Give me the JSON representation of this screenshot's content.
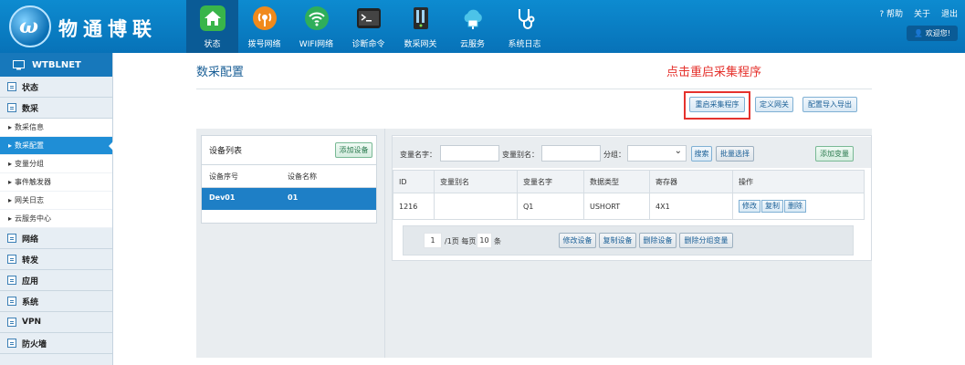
{
  "header": {
    "logo_text": "物通博联",
    "logo_mark": "ω",
    "nav": [
      {
        "label": "状态",
        "icon": "home-icon",
        "active": true
      },
      {
        "label": "拨号网络",
        "icon": "broadcast-icon",
        "active": false
      },
      {
        "label": "WIFI网络",
        "icon": "wifi-icon",
        "active": false
      },
      {
        "label": "诊断命令",
        "icon": "terminal-icon",
        "active": false
      },
      {
        "label": "数采网关",
        "icon": "gateway-icon",
        "active": false
      },
      {
        "label": "云服务",
        "icon": "cloud-icon",
        "active": false
      },
      {
        "label": "系统日志",
        "icon": "stethoscope-icon",
        "active": false
      }
    ],
    "help": "? 帮助",
    "about": "关于",
    "logout": "退出",
    "welcome": "欢迎您!"
  },
  "sidebar": {
    "brand": "WTBLNET",
    "sections": [
      {
        "label": "状态",
        "items": []
      },
      {
        "label": "数采",
        "items": [
          {
            "label": "数采信息",
            "active": false
          },
          {
            "label": "数采配置",
            "active": true
          },
          {
            "label": "变量分组",
            "active": false
          },
          {
            "label": "事件触发器",
            "active": false
          },
          {
            "label": "网关日志",
            "active": false
          },
          {
            "label": "云服务中心",
            "active": false
          }
        ]
      },
      {
        "label": "网络",
        "items": []
      },
      {
        "label": "转发",
        "items": []
      },
      {
        "label": "应用",
        "items": []
      },
      {
        "label": "系统",
        "items": []
      },
      {
        "label": "VPN",
        "items": []
      },
      {
        "label": "防火墙",
        "items": []
      }
    ]
  },
  "main": {
    "title": "数采配置",
    "annotation": "点击重启采集程序",
    "toolbar": {
      "restart": "重启采集程序",
      "define_gateway": "定义网关",
      "import_export": "配置导入导出"
    },
    "devices": {
      "title": "设备列表",
      "add": "添加设备",
      "col_id": "设备序号",
      "col_name": "设备名称",
      "rows": [
        {
          "id": "Dev01",
          "name": "01"
        }
      ]
    },
    "vars": {
      "name_label": "变量名字：",
      "alias_label": "变量别名：",
      "group_label": "分组：",
      "search": "搜索",
      "batch": "批量选择",
      "add": "添加变量",
      "columns": [
        "ID",
        "变量别名",
        "变量名字",
        "数据类型",
        "寄存器",
        "操作"
      ],
      "rows": [
        {
          "id": "1216",
          "alias": "",
          "name": "Q1",
          "type": "USHORT",
          "reg": "4X1"
        }
      ],
      "row_actions": {
        "edit": "修改",
        "copy": "复制",
        "delete": "删除"
      }
    },
    "pager": {
      "page": "1",
      "of": "/1页 每页",
      "per_page": "10",
      "unit": "条",
      "edit_device": "修改设备",
      "copy_device": "复制设备",
      "delete_device": "删除设备",
      "delete_group_vars": "删除分组变量"
    }
  },
  "colors": {
    "header": "#0d8bd0",
    "accent": "#1e7fc6",
    "annotation": "#e5322d"
  }
}
